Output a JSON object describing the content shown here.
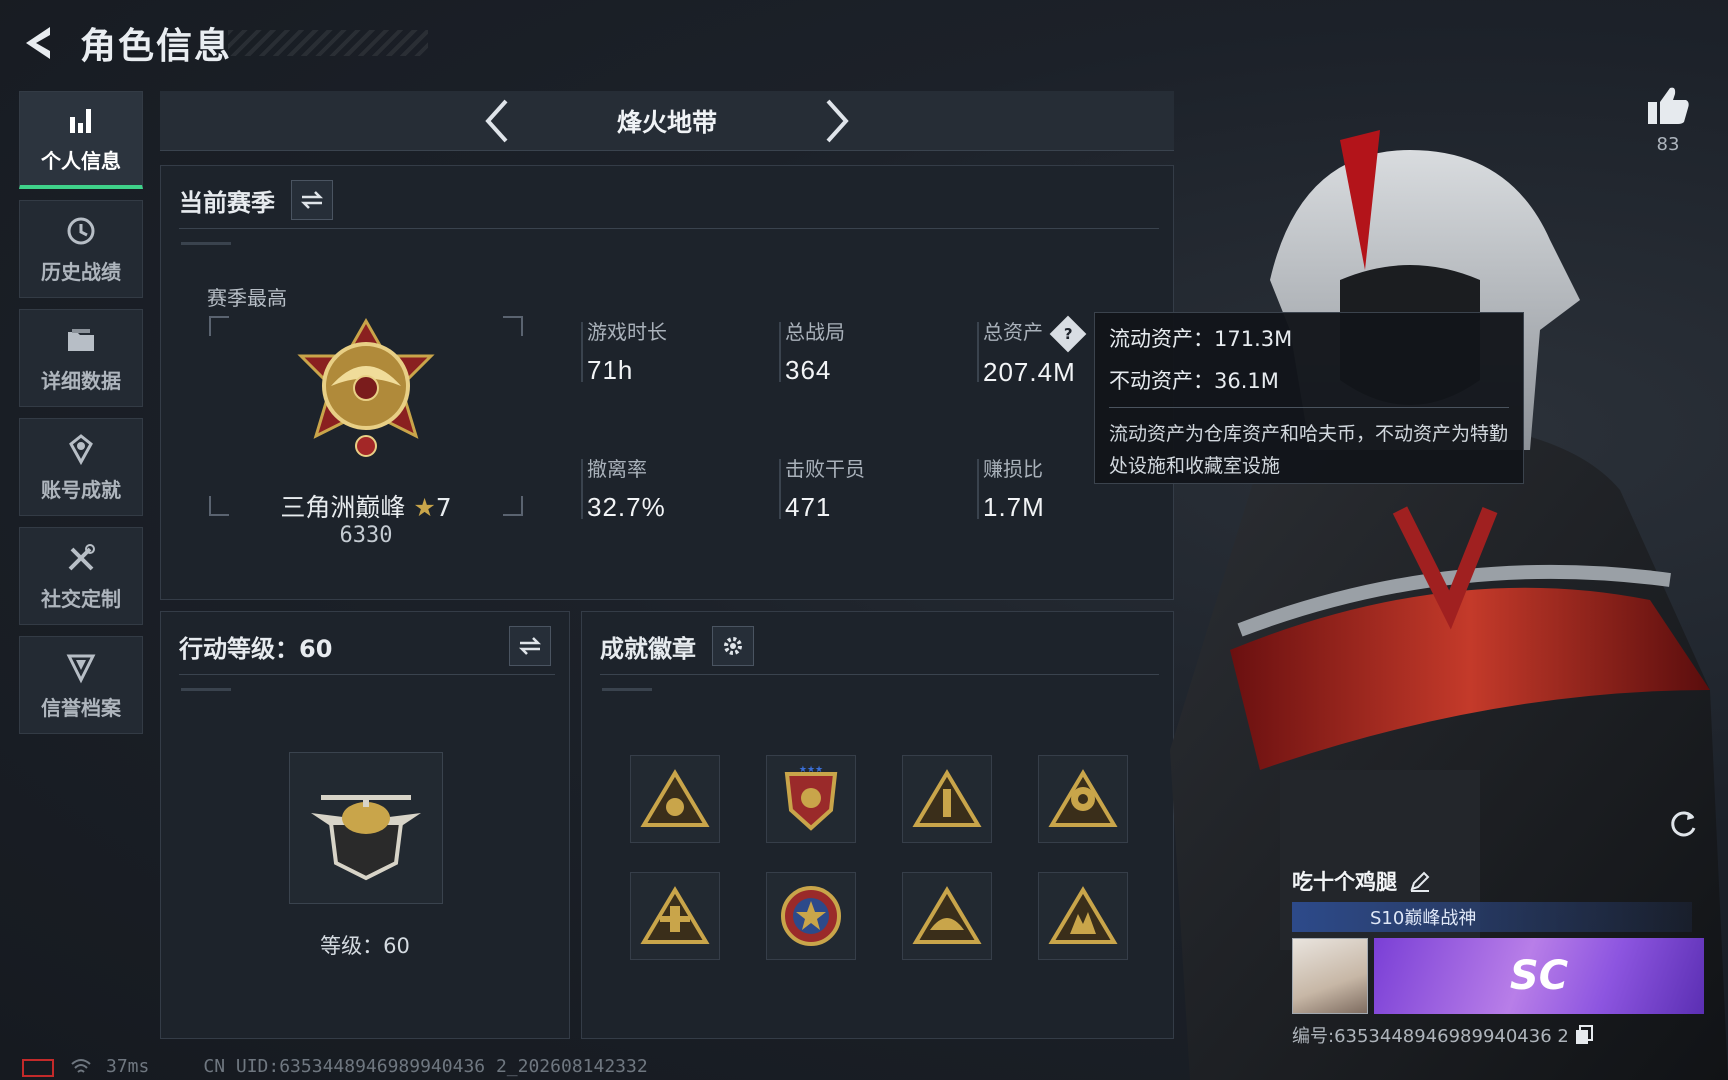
{
  "header": {
    "title": "角色信息"
  },
  "sidebar": {
    "items": [
      {
        "label": "个人信息",
        "icon": "bar-chart-icon",
        "active": true
      },
      {
        "label": "历史战绩",
        "icon": "history-clock-icon"
      },
      {
        "label": "详细数据",
        "icon": "folder-icon"
      },
      {
        "label": "账号成就",
        "icon": "achievement-badge-icon"
      },
      {
        "label": "社交定制",
        "icon": "tools-icon"
      },
      {
        "label": "信誉档案",
        "icon": "shield-emblem-icon"
      }
    ]
  },
  "mode": {
    "title": "烽火地带"
  },
  "season": {
    "title": "当前赛季",
    "subtitle": "赛季最高",
    "rank_name": "三角洲巅峰",
    "rank_stars": "7",
    "rank_score": "6330",
    "stats": [
      {
        "label": "游戏时长",
        "value": "71h"
      },
      {
        "label": "总战局",
        "value": "364"
      },
      {
        "label": "总资产",
        "value": "207.4M"
      },
      {
        "label": "撤离率",
        "value": "32.7%"
      },
      {
        "label": "击败干员",
        "value": "471"
      },
      {
        "label": "赚损比",
        "value": "1.7M"
      }
    ]
  },
  "tooltip": {
    "liquid": "流动资产：171.3M",
    "fixed": "不动资产：36.1M",
    "description": "流动资产为仓库资产和哈夫币，不动资产为特勤处设施和收藏室设施"
  },
  "action_level": {
    "title": "行动等级：60",
    "level_text": "等级：60"
  },
  "achievements": {
    "title": "成就徽章",
    "badges": [
      "badge-1",
      "badge-2",
      "badge-3",
      "badge-4",
      "badge-5",
      "badge-6",
      "badge-7",
      "badge-8"
    ]
  },
  "likes": {
    "count": "83"
  },
  "card": {
    "name": "吃十个鸡腿",
    "title": "S10巅峰战神",
    "banner_text": "SC",
    "uid": "编号:6353448946989940436 2"
  },
  "footer": {
    "ping": "37ms",
    "uid": "CN UID:6353448946989940436 2_202608142332"
  },
  "colors": {
    "accent": "#3fd28a",
    "gold": "#c9a54a",
    "tooltip_bg": "#12151a"
  }
}
